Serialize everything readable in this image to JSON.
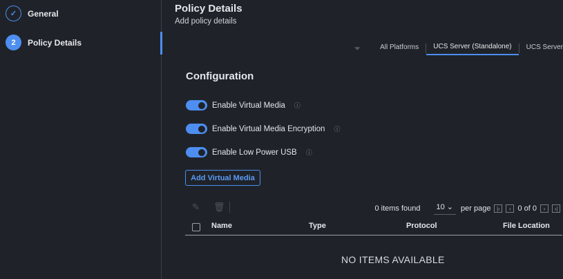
{
  "steps": [
    {
      "label": "General",
      "state": "done",
      "icon": "check-icon"
    },
    {
      "number": "2",
      "label": "Policy Details",
      "state": "current"
    }
  ],
  "header": {
    "title": "Policy Details",
    "subtitle": "Add policy details"
  },
  "platform_tabs": {
    "filter_icon": "filter-icon",
    "items": [
      "All Platforms",
      "UCS Server (Standalone)",
      "UCS Server"
    ],
    "selected": "UCS Server (Standalone)"
  },
  "configuration": {
    "title": "Configuration",
    "toggles": [
      {
        "label": "Enable Virtual Media",
        "on": true
      },
      {
        "label": "Enable Virtual Media Encryption",
        "on": true
      },
      {
        "label": "Enable Low Power USB",
        "on": true
      }
    ],
    "add_button": "Add Virtual Media"
  },
  "table": {
    "items_found": "0 items found",
    "page_size": "10",
    "per_page": "per page",
    "page_info": "0 of 0",
    "columns": [
      "Name",
      "Type",
      "Protocol",
      "File Location"
    ],
    "empty": "NO ITEMS AVAILABLE"
  },
  "colors": {
    "accent": "#4d8ef0",
    "background": "#1f2329"
  }
}
